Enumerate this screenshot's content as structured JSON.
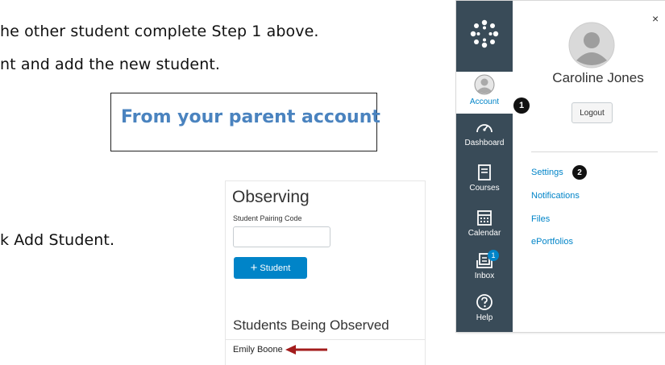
{
  "doc": {
    "line1": "he other student complete Step 1 above.",
    "line2": "nt and add the new student.",
    "callout": "From your parent account",
    "line3": "k Add Student."
  },
  "observing": {
    "title": "Observing",
    "pairing_label": "Student Pairing Code",
    "pairing_value": "",
    "button_plus": "+",
    "button_label": "Student",
    "section_title": "Students Being Observed",
    "students": [
      "Emily Boone"
    ],
    "accent": "#0084c8",
    "arrow_color": "#a31c1c"
  },
  "canvas": {
    "nav_bg": "#394b58",
    "nav": {
      "account": "Account",
      "dashboard": "Dashboard",
      "courses": "Courses",
      "calendar": "Calendar",
      "inbox": "Inbox",
      "inbox_badge": "1",
      "help": "Help"
    },
    "tray": {
      "close": "×",
      "name": "Caroline Jones",
      "logout": "Logout",
      "links": [
        "Settings",
        "Notifications",
        "Files",
        "ePortfolios"
      ]
    },
    "step_badges": [
      "1",
      "2"
    ]
  }
}
